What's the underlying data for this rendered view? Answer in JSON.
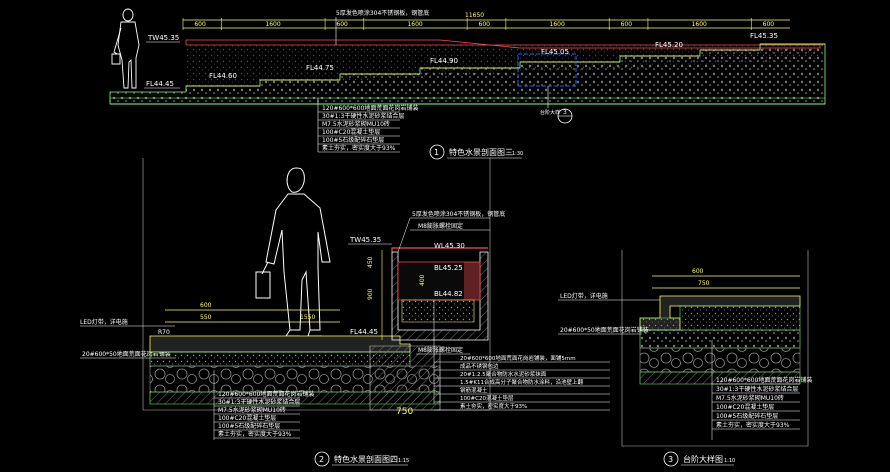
{
  "colors": {
    "background": "#000000",
    "white": "#ffffff",
    "yellow": "#ffff66",
    "green": "#7fff7f",
    "red": "#ff4d4d",
    "cyan": "#66ffff",
    "blue": "#2c5cff",
    "grey": "#9a9a9a"
  },
  "section1": {
    "title_num": "1",
    "title": "特色水景剖面图三",
    "scale": "1:30",
    "top_note": "5厚发色喷涂304不锈钢板，钢管底",
    "total_dim": "11650",
    "dims": [
      "600",
      "1600",
      "600",
      "1600",
      "600",
      "1600",
      "600",
      "1600",
      "600"
    ],
    "levels": [
      "TW45.35",
      "FL44.45",
      "FL44.60",
      "FL44.75",
      "FL44.90",
      "FL45.05",
      "FL45.20",
      "FL45.35"
    ],
    "layers": [
      "120#600*600地面荒面花岗岩铺装",
      "30#1:3干硬性水泥砂浆结合层",
      "M7.5水泥砂浆砌MU10砖",
      "100#C20混凝土垫层",
      "100#5石级配碎石垫层",
      "素土夯实，密实度大于93%"
    ],
    "callout_note": "台阶大样",
    "callout_num": "3"
  },
  "section2": {
    "title_num": "2",
    "title": "特色水景剖面图四",
    "scale": "1:15",
    "top_note": "5厚发色喷涂304不锈钢板，钢管底",
    "m8": "M8膨胀螺栓固定",
    "levels": [
      "TW45.35",
      "WL45.30",
      "BL45.25",
      "BL44.82",
      "FL44.45"
    ],
    "dims_top": [
      "600",
      "550",
      "1550"
    ],
    "led": "LED灯带，详电施",
    "r70": "R70",
    "paving": "20#600*50地面荒面花岗岩铺装",
    "water_layers": [
      "20#600*600地面荒面花岗岩铺装，面铺5mm",
      "成品不锈钢包边",
      "20#1:2.5聚合物防水水泥砂浆抹面",
      "1.5#K11合成高分子聚合物防水涂料，沿池壁上翻",
      "钢筋混凝土",
      "100#C20混凝土垫层",
      "素土夯实，密实度大于93%"
    ],
    "m8b": "M8膨胀螺栓固定",
    "layers": [
      "120#600*600地面荒面花岗岩铺装",
      "30#1:3干硬性水泥砂浆结合层",
      "M7.5水泥砂浆砌MU10砖",
      "100#C20混凝土垫层",
      "100#5石级配碎石垫层",
      "素土夯实，密实度大于93%"
    ],
    "dims_side": [
      "450",
      "900",
      "400"
    ],
    "bottom_dim": "750"
  },
  "section3": {
    "title_num": "3",
    "title": "台阶大样图",
    "scale": "1:10",
    "led": "LED灯带，详电施",
    "paving": "20#600*50地面荒面花岗岩铺装",
    "dims": [
      "600",
      "750"
    ],
    "layers": [
      "120#600*600地面荒面花岗岩铺装",
      "30#1:3干硬性水泥砂浆结合层",
      "M7.5水泥砂浆砌MU10砖",
      "100#C20混凝土垫层",
      "100#5石级配碎石垫层",
      "素土夯实，密实度大于93%"
    ]
  }
}
